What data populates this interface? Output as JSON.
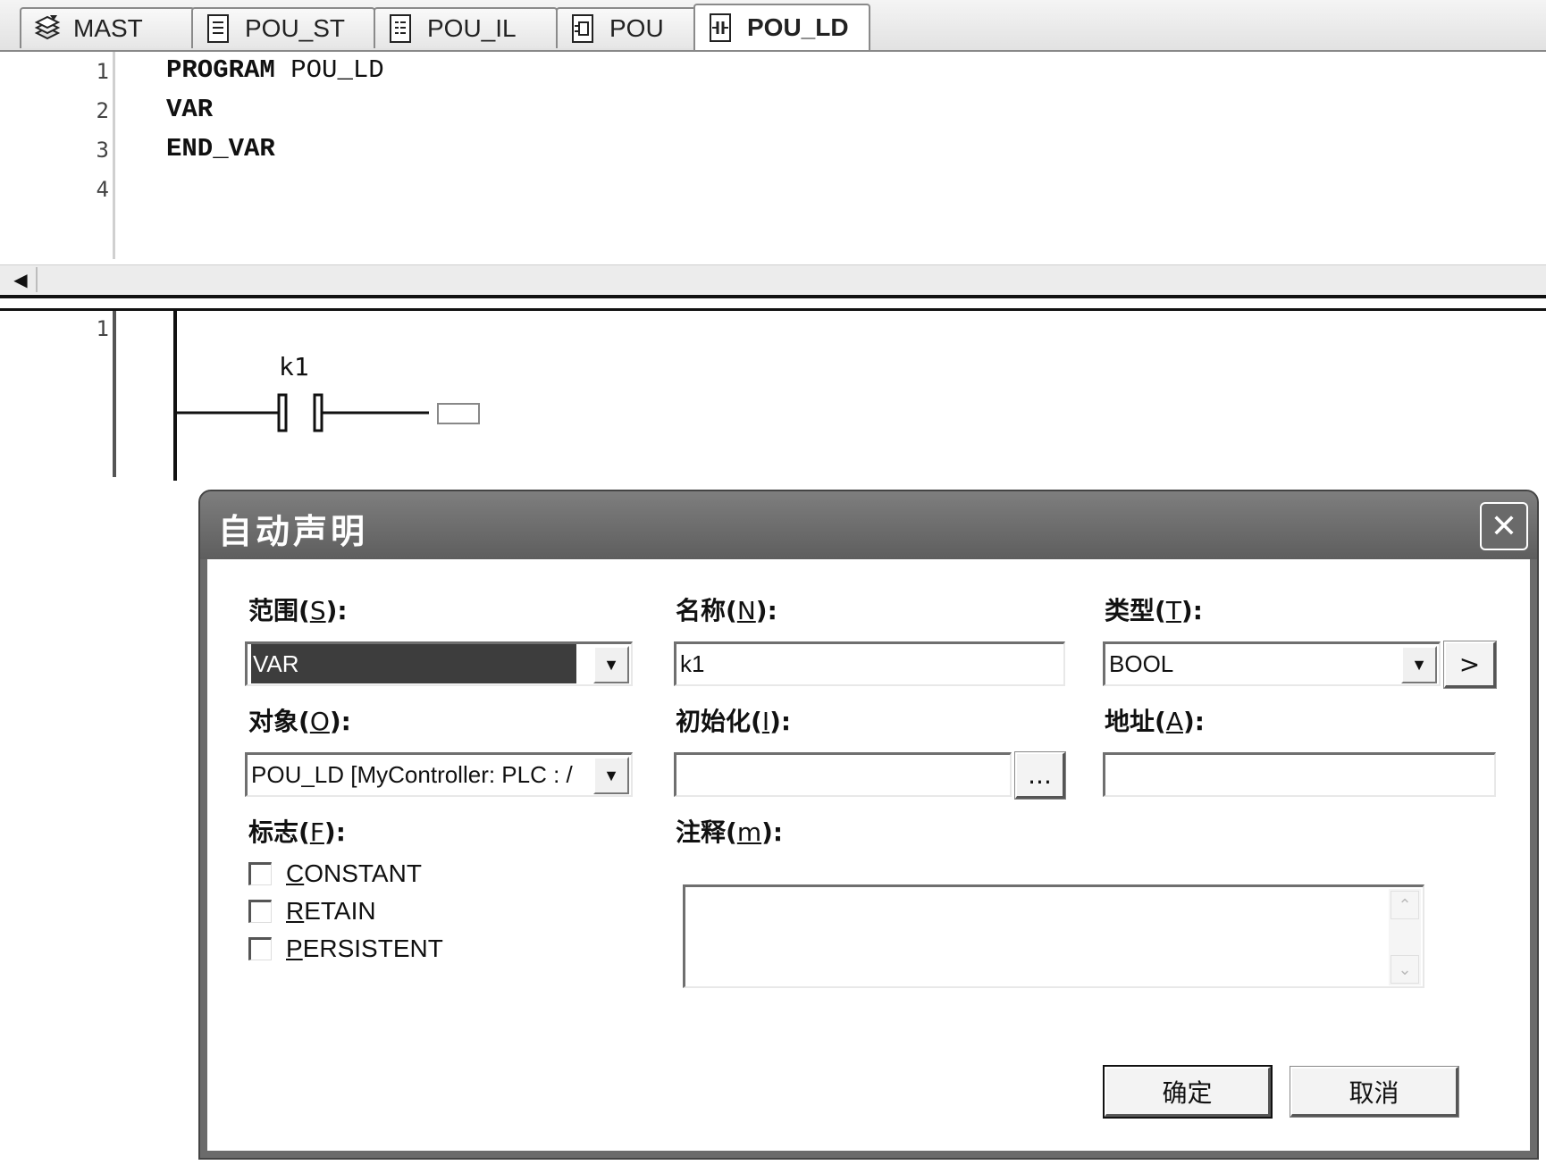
{
  "tabs": [
    {
      "label": "MAST",
      "icon": "tasks-icon",
      "active": false
    },
    {
      "label": "POU_ST",
      "icon": "st-document-icon",
      "active": false
    },
    {
      "label": "POU_IL",
      "icon": "il-document-icon",
      "active": false
    },
    {
      "label": "POU",
      "icon": "fbd-document-icon",
      "active": false
    },
    {
      "label": "POU_LD",
      "icon": "ld-document-icon",
      "active": true
    }
  ],
  "declaration": {
    "line_numbers": [
      "1",
      "2",
      "3",
      "4"
    ],
    "lines": [
      {
        "keyword": "PROGRAM",
        "rest": " POU_LD"
      },
      {
        "keyword": "VAR",
        "rest": ""
      },
      {
        "keyword": "END_VAR",
        "rest": ""
      },
      {
        "keyword": "",
        "rest": ""
      }
    ]
  },
  "ladder": {
    "rung_number": "1",
    "contact_label": "k1"
  },
  "dialog": {
    "title": "自动声明",
    "scope": {
      "label": "范围(",
      "accel": "S",
      "label_end": "):",
      "value": "VAR"
    },
    "name": {
      "label": "名称(",
      "accel": "N",
      "label_end": "):",
      "value": "k1"
    },
    "type": {
      "label": "类型(",
      "accel": "T",
      "label_end": "):",
      "value": "BOOL",
      "browse_label": ">"
    },
    "object": {
      "label": "对象(",
      "accel": "O",
      "label_end": "):",
      "value": "POU_LD [MyController: PLC : /"
    },
    "init": {
      "label": "初始化(",
      "accel": "I",
      "label_end": "):",
      "value": "",
      "browse_label": "..."
    },
    "address": {
      "label": "地址(",
      "accel": "A",
      "label_end": "):",
      "value": ""
    },
    "flags": {
      "label": "标志(",
      "accel": "F",
      "label_end": "):",
      "items": [
        {
          "first": "C",
          "rest": "ONSTANT",
          "checked": false
        },
        {
          "first": "R",
          "rest": "ETAIN",
          "checked": false
        },
        {
          "first": "P",
          "rest": "ERSISTENT",
          "checked": false
        }
      ]
    },
    "comment": {
      "label": "注释(",
      "accel": "m",
      "label_end": "):",
      "value": ""
    },
    "ok_label": "确定",
    "cancel_label": "取消"
  }
}
